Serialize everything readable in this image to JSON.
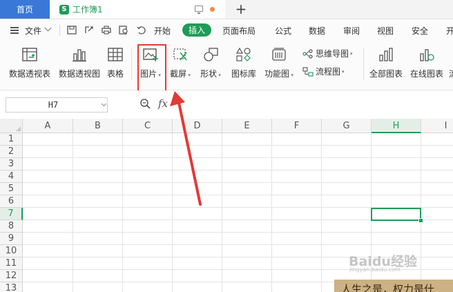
{
  "titlebar": {
    "home_tab": "首页",
    "document_tab": "工作簿1",
    "workbook_logo": "S",
    "new_tab_symbol": "+"
  },
  "menubar": {
    "file_label": "文件",
    "items": [
      "开始",
      "插入",
      "页面布局",
      "公式",
      "数据",
      "审阅",
      "视图",
      "安全",
      "开"
    ],
    "active_item": "插入"
  },
  "ribbon": {
    "buttons": [
      {
        "label": "数据透视表",
        "icon": "pivot-table-icon"
      },
      {
        "label": "数据透视图",
        "icon": "pivot-chart-icon"
      },
      {
        "label": "表格",
        "icon": "table-icon"
      },
      {
        "label": "图片",
        "icon": "picture-icon"
      },
      {
        "label": "截屏",
        "icon": "screenshot-icon"
      },
      {
        "label": "形状",
        "icon": "shapes-icon"
      },
      {
        "label": "图标库",
        "icon": "icon-library-icon"
      },
      {
        "label": "功能图",
        "icon": "function-chart-icon"
      },
      {
        "label": "全部图表",
        "icon": "all-charts-icon"
      },
      {
        "label": "在线图表",
        "icon": "online-chart-icon"
      },
      {
        "label": "流",
        "icon": ""
      }
    ],
    "small_buttons": [
      {
        "label": "思维导图",
        "icon": "mindmap-icon"
      },
      {
        "label": "流程图",
        "icon": "flowchart-icon"
      }
    ]
  },
  "formula_bar": {
    "name_box": "H7",
    "fx_label": "fx",
    "formula_value": ""
  },
  "sheet": {
    "columns": [
      "A",
      "B",
      "C",
      "D",
      "E",
      "F",
      "G",
      "H",
      "I"
    ],
    "rows": [
      "1",
      "2",
      "3",
      "4",
      "5",
      "6",
      "7",
      "8",
      "9",
      "10",
      "11",
      "12",
      "13"
    ],
    "active_column": "H",
    "active_row": "7"
  },
  "overlays": {
    "watermark": "Baidu经验",
    "watermark_sub": "jingyan.baidu.com",
    "banner_text": "人生之是，权力是什"
  },
  "colors": {
    "accent_green": "#1e9c58",
    "home_tab_blue": "#3a78d8",
    "annotation_red": "#e53935"
  }
}
